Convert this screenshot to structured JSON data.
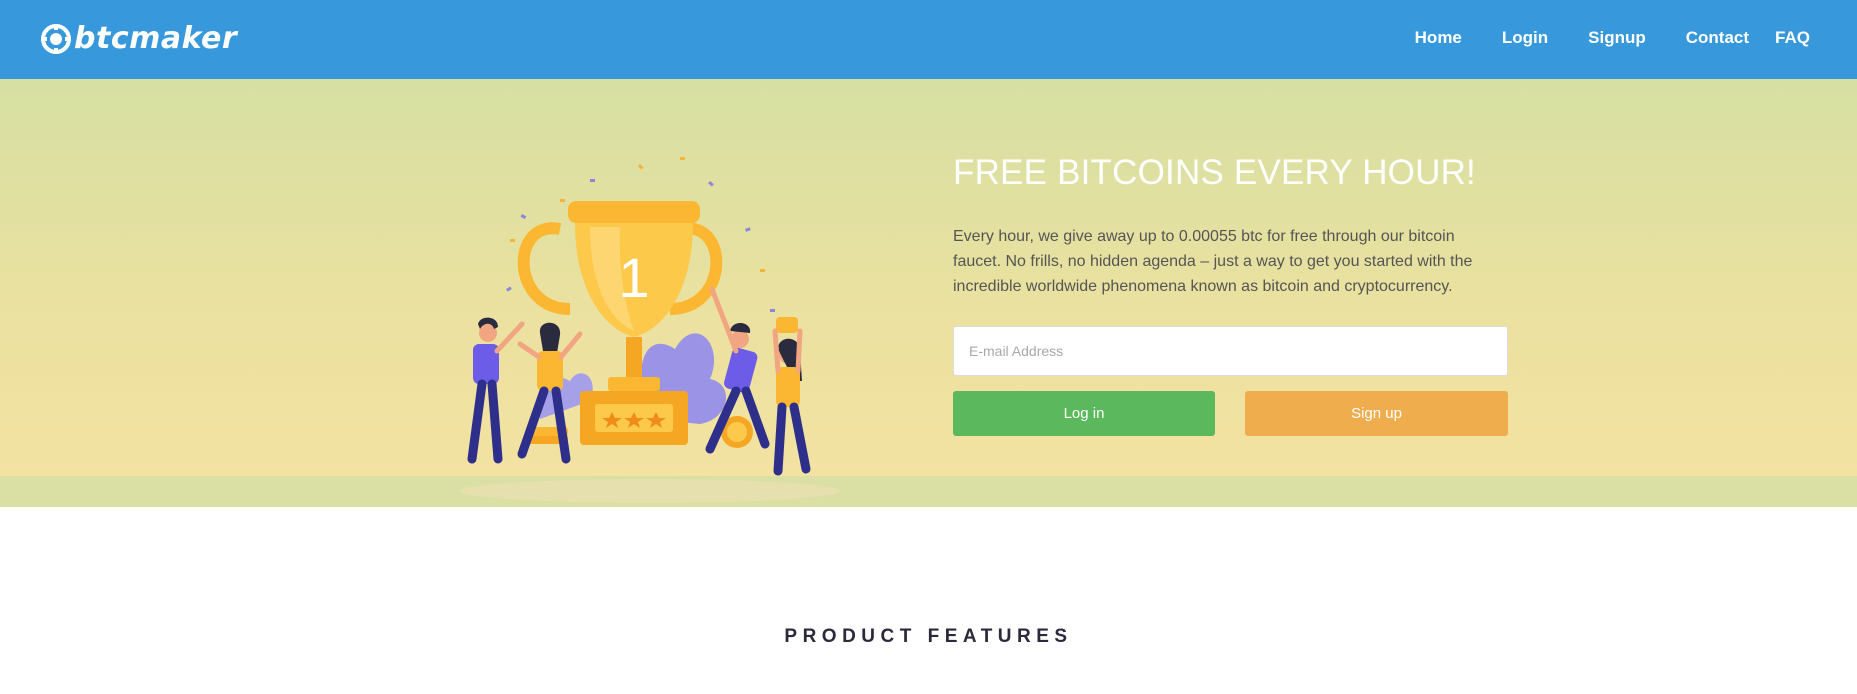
{
  "brand": {
    "name": "btcmaker",
    "logo_icon": "bitcoin-gear-icon"
  },
  "nav": {
    "items": [
      "Home",
      "Login",
      "Signup",
      "Contact",
      "FAQ"
    ]
  },
  "hero": {
    "title": "FREE BITCOINS EVERY HOUR!",
    "description": "Every hour, we give away up to 0.00055 btc for free through our bitcoin faucet. No frills, no hidden agenda – just a way to get you started with the incredible worldwide phenomena known as bitcoin and cryptocurrency.",
    "email_placeholder": "E-mail Address",
    "email_value": "",
    "login_button": "Log in",
    "signup_button": "Sign up",
    "trophy_number": "1"
  },
  "features": {
    "title": "PRODUCT FEATURES"
  },
  "colors": {
    "header": "#3798dc",
    "login": "#5cb85c",
    "signup": "#f0ad4e",
    "trophy": "#fbb731",
    "figure_purple": "#6c5ce7"
  }
}
